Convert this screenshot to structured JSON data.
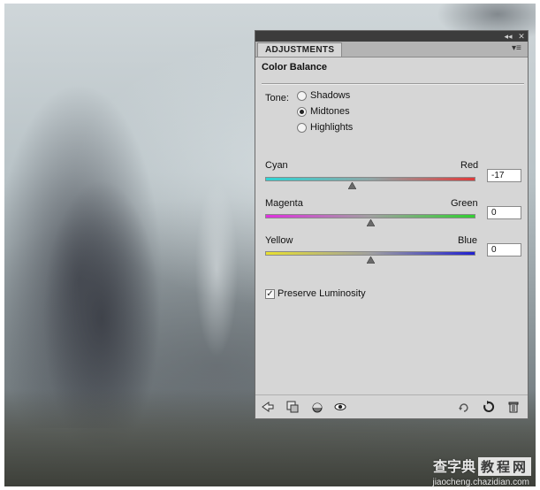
{
  "panel": {
    "tab_label": "ADJUSTMENTS",
    "title": "Color Balance",
    "tone": {
      "label": "Tone:",
      "options": [
        "Shadows",
        "Midtones",
        "Highlights"
      ],
      "selected": "Midtones"
    },
    "sliders": [
      {
        "left": "Cyan",
        "right": "Red",
        "value": "-17",
        "position": -17
      },
      {
        "left": "Magenta",
        "right": "Green",
        "value": "0",
        "position": 0
      },
      {
        "left": "Yellow",
        "right": "Blue",
        "value": "0",
        "position": 0
      }
    ],
    "preserve_luminosity": {
      "label": "Preserve Luminosity",
      "checked": true
    },
    "footer_icons": [
      "back-arrow-icon",
      "clip-to-layer-icon",
      "view-previous-state-icon",
      "visibility-eye-icon",
      "reset-icon",
      "refresh-icon",
      "trash-icon"
    ]
  },
  "watermark": {
    "brand": "查字典",
    "box": "教程网",
    "url": "jiaocheng.chazidian.com"
  }
}
